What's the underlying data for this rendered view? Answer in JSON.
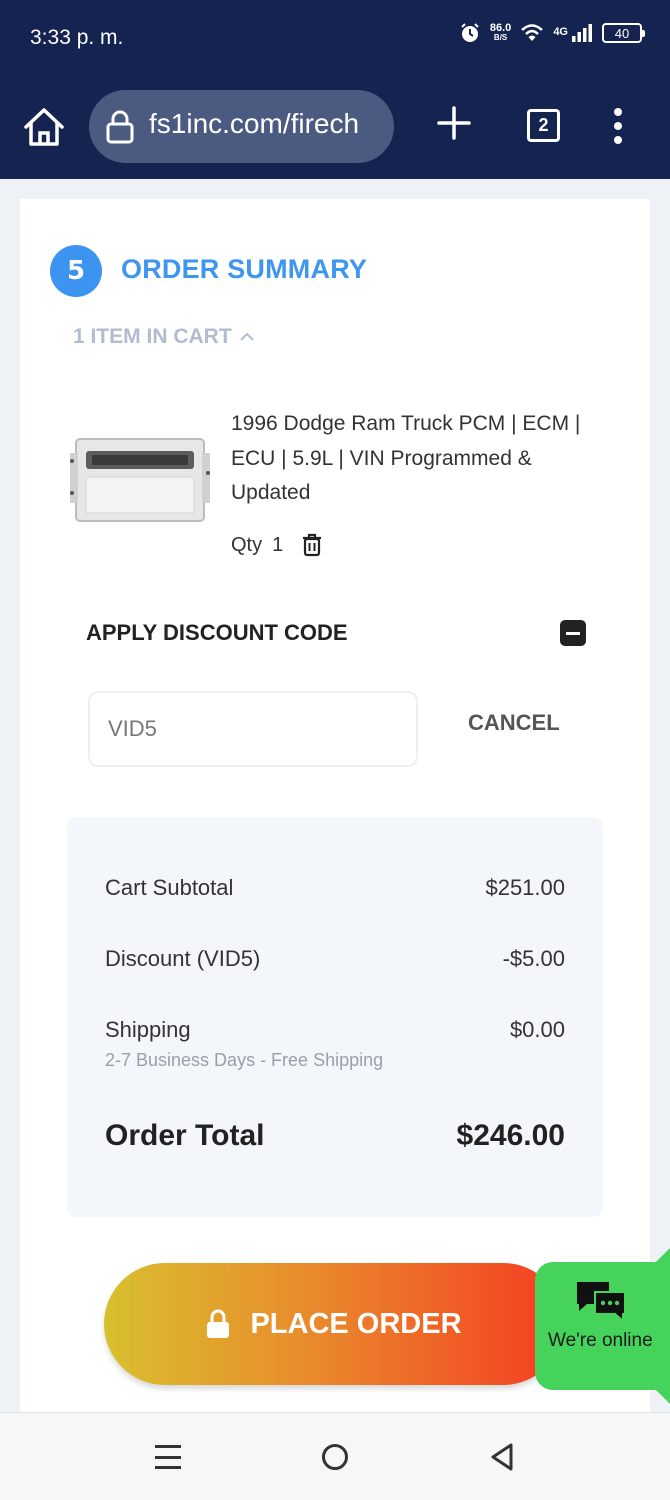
{
  "status_bar": {
    "time": "3:33 p. m.",
    "speed_value": "86.0",
    "speed_unit": "B/S",
    "network": "4G",
    "battery": "40",
    "icons": [
      "alarm-icon",
      "wifi-icon",
      "signal-icon",
      "battery-icon"
    ]
  },
  "browser": {
    "url": "fs1inc.com/firech",
    "tab_count": "2",
    "icons": [
      "home-icon",
      "lock-icon",
      "plus-icon",
      "tabs-icon",
      "more-icon"
    ]
  },
  "order_summary": {
    "step": "5",
    "title": "ORDER SUMMARY",
    "items_toggle": "1 ITEM IN CART",
    "item": {
      "name": "1996 Dodge Ram Truck PCM | ECM | ECU | 5.9L | VIN Programmed & Updated",
      "qty_label": "Qty",
      "qty_value": "1"
    }
  },
  "discount": {
    "title": "APPLY DISCOUNT CODE",
    "code_value": "VID5",
    "cancel_label": "CANCEL"
  },
  "totals": {
    "subtotal_label": "Cart Subtotal",
    "subtotal_value": "$251.00",
    "discount_label": "Discount (VID5)",
    "discount_value": "-$5.00",
    "shipping_label": "Shipping",
    "shipping_value": "$0.00",
    "shipping_note": "2-7 Business Days - Free Shipping",
    "total_label": "Order Total",
    "total_value": "$246.00"
  },
  "place_order_label": "PLACE ORDER",
  "chat": {
    "label": "We're online"
  },
  "colors": {
    "header_bg": "#152350",
    "accent_blue": "#3d93f0",
    "chat_green": "#46d35c",
    "button_gradient_start": "#d8c02e",
    "button_gradient_end": "#f53d22"
  }
}
